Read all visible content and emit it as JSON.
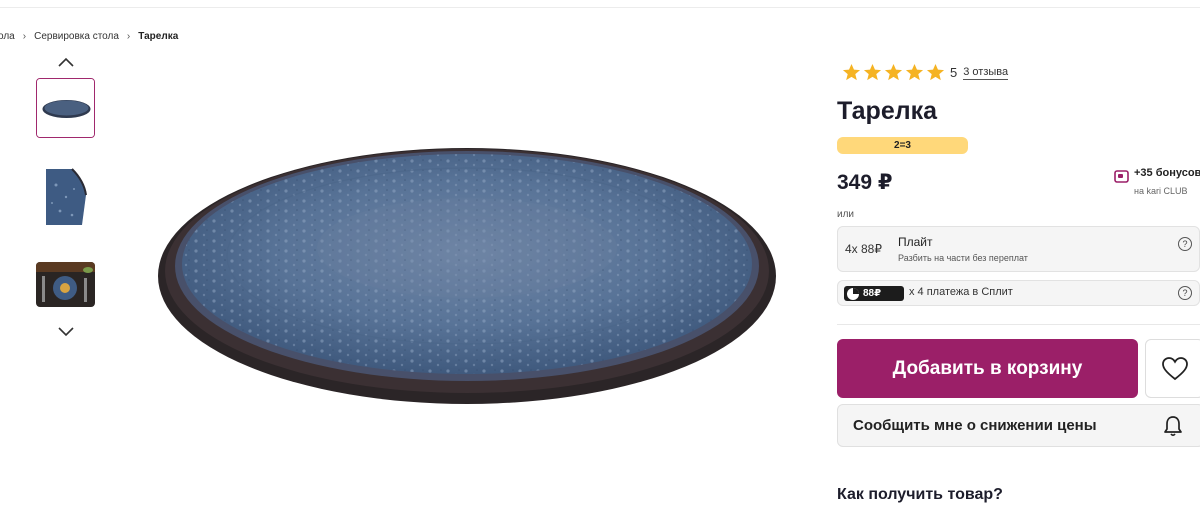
{
  "breadcrumb": {
    "items": [
      "ола",
      "Сервировка стола"
    ],
    "current": "Тарелка"
  },
  "gallery": {
    "thumbnails": [
      "plate-top-view",
      "plate-detail",
      "plate-table-setting"
    ],
    "active_index": 0
  },
  "product": {
    "rating_value": "5",
    "reviews_label": "3 отзыва",
    "title": "Тарелка",
    "promo": "2=3",
    "price": "349 ₽",
    "bonus_title": "+35 бонусов",
    "bonus_sub": "на kari CLUB",
    "or_label": "или"
  },
  "payments": {
    "plait": {
      "amount": "4x 88₽",
      "name": "Плайт",
      "desc": "Разбить на части без переплат",
      "help": "?"
    },
    "split": {
      "tag": "88₽",
      "text": "x 4 платежа в Сплит",
      "help": "?"
    }
  },
  "actions": {
    "add_to_cart": "Добавить в корзину",
    "notify_price": "Сообщить мне о снижении цены"
  },
  "delivery": {
    "heading": "Как получить товар?"
  },
  "colors": {
    "accent": "#9b1f68",
    "promo": "#ffd87a",
    "star": "#f5b323"
  }
}
